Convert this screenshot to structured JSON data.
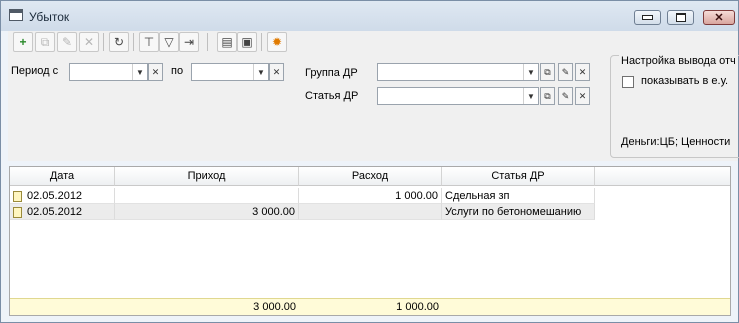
{
  "window": {
    "title": "Убыток",
    "app_icon": "form-icon",
    "controls": [
      "minimize-icon",
      "maximize-icon",
      "close-icon"
    ]
  },
  "toolbar": {
    "buttons": [
      {
        "name": "add-button",
        "icon": "+",
        "enabled": true
      },
      {
        "name": "copy-button",
        "icon": "⧉",
        "enabled": false
      },
      {
        "name": "edit-button",
        "icon": "✎",
        "enabled": false
      },
      {
        "name": "delete-button",
        "icon": "✕",
        "enabled": false
      },
      {
        "name": "refresh-button",
        "icon": "↻",
        "enabled": true
      },
      {
        "name": "hierarchy-button",
        "icon": "⊤",
        "enabled": true
      },
      {
        "name": "filter-button",
        "icon": "▽",
        "enabled": true
      },
      {
        "name": "filter-clear-button",
        "icon": "⇥",
        "enabled": true
      },
      {
        "name": "report-button",
        "icon": "▤",
        "enabled": true
      },
      {
        "name": "save-button",
        "icon": "▣",
        "enabled": true
      },
      {
        "name": "settings-button",
        "icon": "✹",
        "enabled": true
      }
    ]
  },
  "filters": {
    "period_from_label": "Период с",
    "period_from_value": "",
    "period_to_label": "по",
    "period_to_value": "",
    "group_label": "Группа ДР",
    "group_value": "",
    "article_label": "Статья ДР",
    "article_value": ""
  },
  "output_settings": {
    "title": "Настройка вывода отч",
    "show_in_units_label": "показывать в е.у.",
    "show_in_units_checked": false,
    "summary": "Деньги:ЦБ; Ценности"
  },
  "table": {
    "columns": [
      "Дата",
      "Приход",
      "Расход",
      "Статья ДР"
    ],
    "rows": [
      {
        "date": "02.05.2012",
        "income": "",
        "expense": "1 000.00",
        "article": "Сдельная зп"
      },
      {
        "date": "02.05.2012",
        "income": "3 000.00",
        "expense": "",
        "article": "Услуги по бетономешанию"
      }
    ],
    "totals": {
      "income": "3 000.00",
      "expense": "1 000.00"
    }
  }
}
